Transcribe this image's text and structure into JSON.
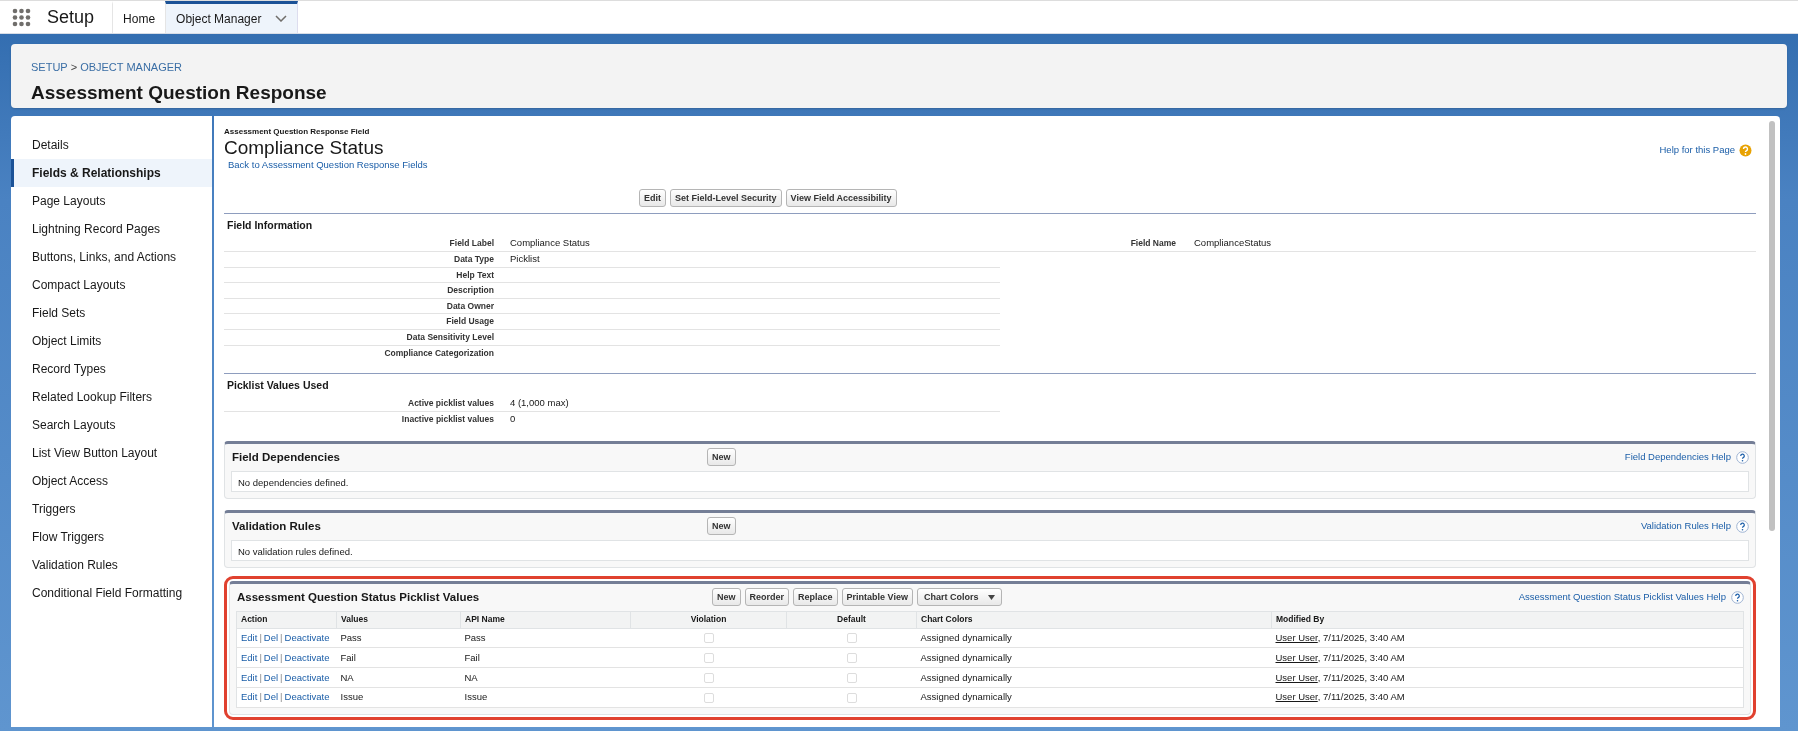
{
  "app": {
    "title": "Setup",
    "tabs": [
      {
        "label": "Home",
        "selected": false,
        "has_menu": false
      },
      {
        "label": "Object Manager",
        "selected": true,
        "has_menu": true
      }
    ]
  },
  "header": {
    "breadcrumb": [
      "SETUP",
      "OBJECT MANAGER"
    ],
    "breadcrumb_separator": ">",
    "title": "Assessment Question Response"
  },
  "sidebar": {
    "items": [
      {
        "label": "Details",
        "selected": false
      },
      {
        "label": "Fields & Relationships",
        "selected": true
      },
      {
        "label": "Page Layouts",
        "selected": false
      },
      {
        "label": "Lightning Record Pages",
        "selected": false
      },
      {
        "label": "Buttons, Links, and Actions",
        "selected": false
      },
      {
        "label": "Compact Layouts",
        "selected": false
      },
      {
        "label": "Field Sets",
        "selected": false
      },
      {
        "label": "Object Limits",
        "selected": false
      },
      {
        "label": "Record Types",
        "selected": false
      },
      {
        "label": "Related Lookup Filters",
        "selected": false
      },
      {
        "label": "Search Layouts",
        "selected": false
      },
      {
        "label": "List View Button Layout",
        "selected": false
      },
      {
        "label": "Object Access",
        "selected": false
      },
      {
        "label": "Triggers",
        "selected": false
      },
      {
        "label": "Flow Triggers",
        "selected": false
      },
      {
        "label": "Validation Rules",
        "selected": false
      },
      {
        "label": "Conditional Field Formatting",
        "selected": false
      }
    ]
  },
  "page": {
    "object_label": "Assessment Question Response Field",
    "title": "Compliance Status",
    "back_link": "Back to Assessment Question Response Fields",
    "help_link": "Help for this Page",
    "buttons": [
      "Edit",
      "Set Field-Level Security",
      "View Field Accessibility"
    ]
  },
  "field_information": {
    "heading": "Field Information",
    "side_field": {
      "label": "Field Name",
      "value": "ComplianceStatus"
    },
    "rows": [
      {
        "label": "Field Label",
        "value": "Compliance Status"
      },
      {
        "label": "Data Type",
        "value": "Picklist"
      },
      {
        "label": "Help Text"
      },
      {
        "label": "Description"
      },
      {
        "label": "Data Owner"
      },
      {
        "label": "Field Usage"
      },
      {
        "label": "Data Sensitivity Level"
      },
      {
        "label": "Compliance Categorization"
      }
    ]
  },
  "picklist_values_used": {
    "heading": "Picklist Values Used",
    "rows": [
      {
        "label": "Active picklist values",
        "value": "4 (1,000 max)"
      },
      {
        "label": "Inactive picklist values",
        "value": "0"
      }
    ]
  },
  "related_lists": [
    {
      "title": "Field Dependencies",
      "buttons": [
        "New"
      ],
      "help": "Field Dependencies Help",
      "empty_message": "No dependencies defined."
    },
    {
      "title": "Validation Rules",
      "buttons": [
        "New"
      ],
      "help": "Validation Rules Help",
      "empty_message": "No validation rules defined."
    }
  ],
  "picklist_values": {
    "title": "Assessment Question Status Picklist Values",
    "highlighted": true,
    "help": "Assessment Question Status Picklist Values Help",
    "buttons": [
      {
        "label": "New",
        "kind": "button"
      },
      {
        "label": "Reorder",
        "kind": "button"
      },
      {
        "label": "Replace",
        "kind": "button"
      },
      {
        "label": "Printable View",
        "kind": "button"
      },
      {
        "label": "Chart Colors",
        "kind": "menu"
      }
    ],
    "columns": [
      "Action",
      "Values",
      "API Name",
      "Violation",
      "Default",
      "Chart Colors",
      "Modified By"
    ],
    "action_separator": "|",
    "rows": [
      {
        "actions": [
          "Edit",
          "Del",
          "Deactivate"
        ],
        "value": "Pass",
        "api_name": "Pass",
        "violation": false,
        "default": false,
        "chart_colors": "Assigned dynamically",
        "modified_by": "User User",
        "modified_date": ", 7/11/2025, 3:40 AM"
      },
      {
        "actions": [
          "Edit",
          "Del",
          "Deactivate"
        ],
        "value": "Fail",
        "api_name": "Fail",
        "violation": false,
        "default": false,
        "chart_colors": "Assigned dynamically",
        "modified_by": "User User",
        "modified_date": ", 7/11/2025, 3:40 AM"
      },
      {
        "actions": [
          "Edit",
          "Del",
          "Deactivate"
        ],
        "value": "NA",
        "api_name": "NA",
        "violation": false,
        "default": false,
        "chart_colors": "Assigned dynamically",
        "modified_by": "User User",
        "modified_date": ", 7/11/2025, 3:40 AM"
      },
      {
        "actions": [
          "Edit",
          "Del",
          "Deactivate"
        ],
        "value": "Issue",
        "api_name": "Issue",
        "violation": false,
        "default": false,
        "chart_colors": "Assigned dynamically",
        "modified_by": "User User",
        "modified_date": ", 7/11/2025, 3:40 AM"
      }
    ]
  }
}
